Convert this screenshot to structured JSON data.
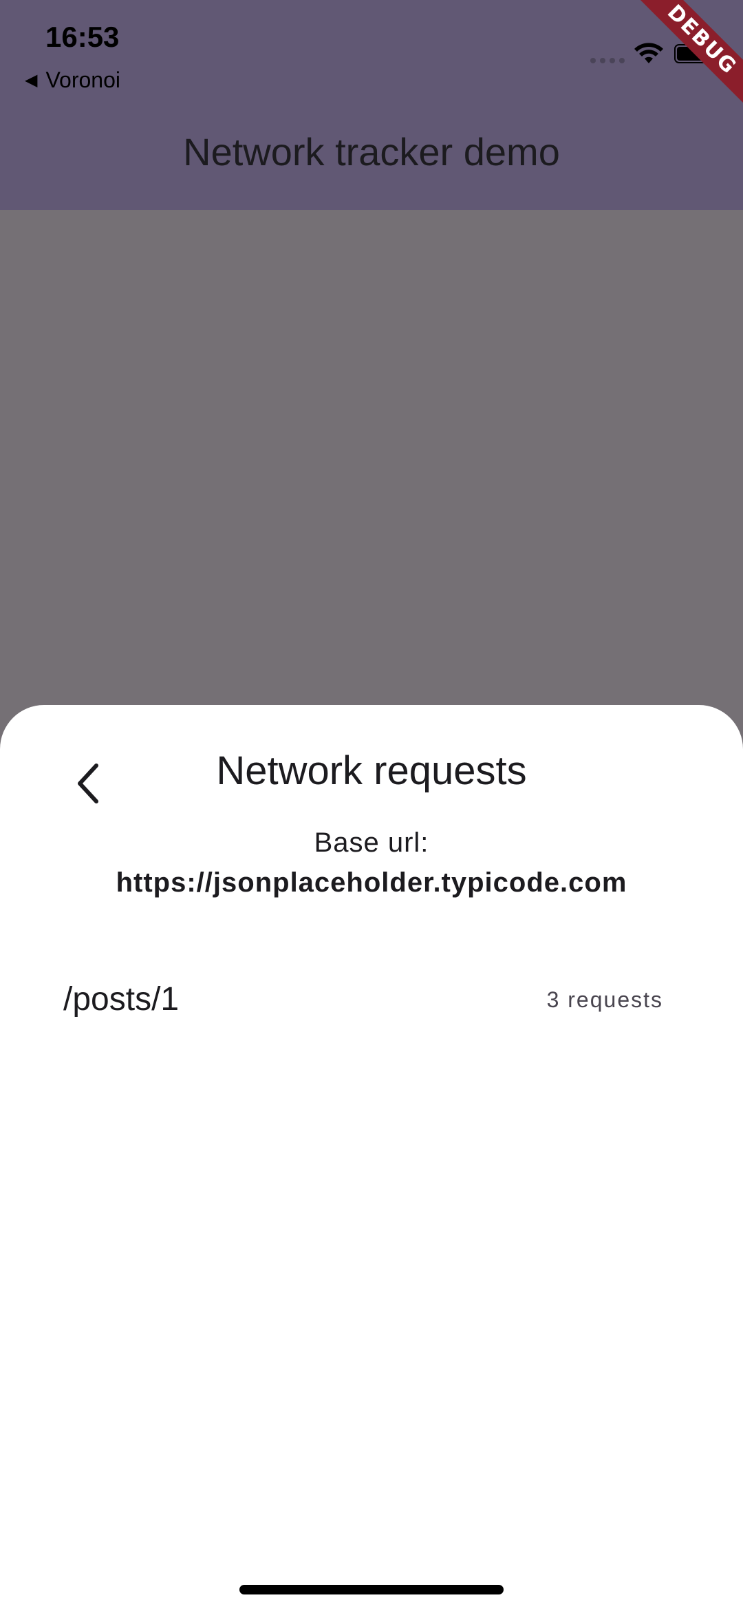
{
  "status_bar": {
    "time": "16:53",
    "back_app": "Voronoi"
  },
  "debug_banner": {
    "label": "DEBUG"
  },
  "app_bar": {
    "title": "Network tracker demo"
  },
  "sheet": {
    "title": "Network requests",
    "base_url_label": "Base url:",
    "base_url_value": "https://jsonplaceholder.typicode.com",
    "endpoints": [
      {
        "path": "/posts/1",
        "count": "3 requests"
      }
    ]
  },
  "colors": {
    "header": "#615874",
    "scrim": "#757075",
    "debug": "#8b1e2b"
  }
}
